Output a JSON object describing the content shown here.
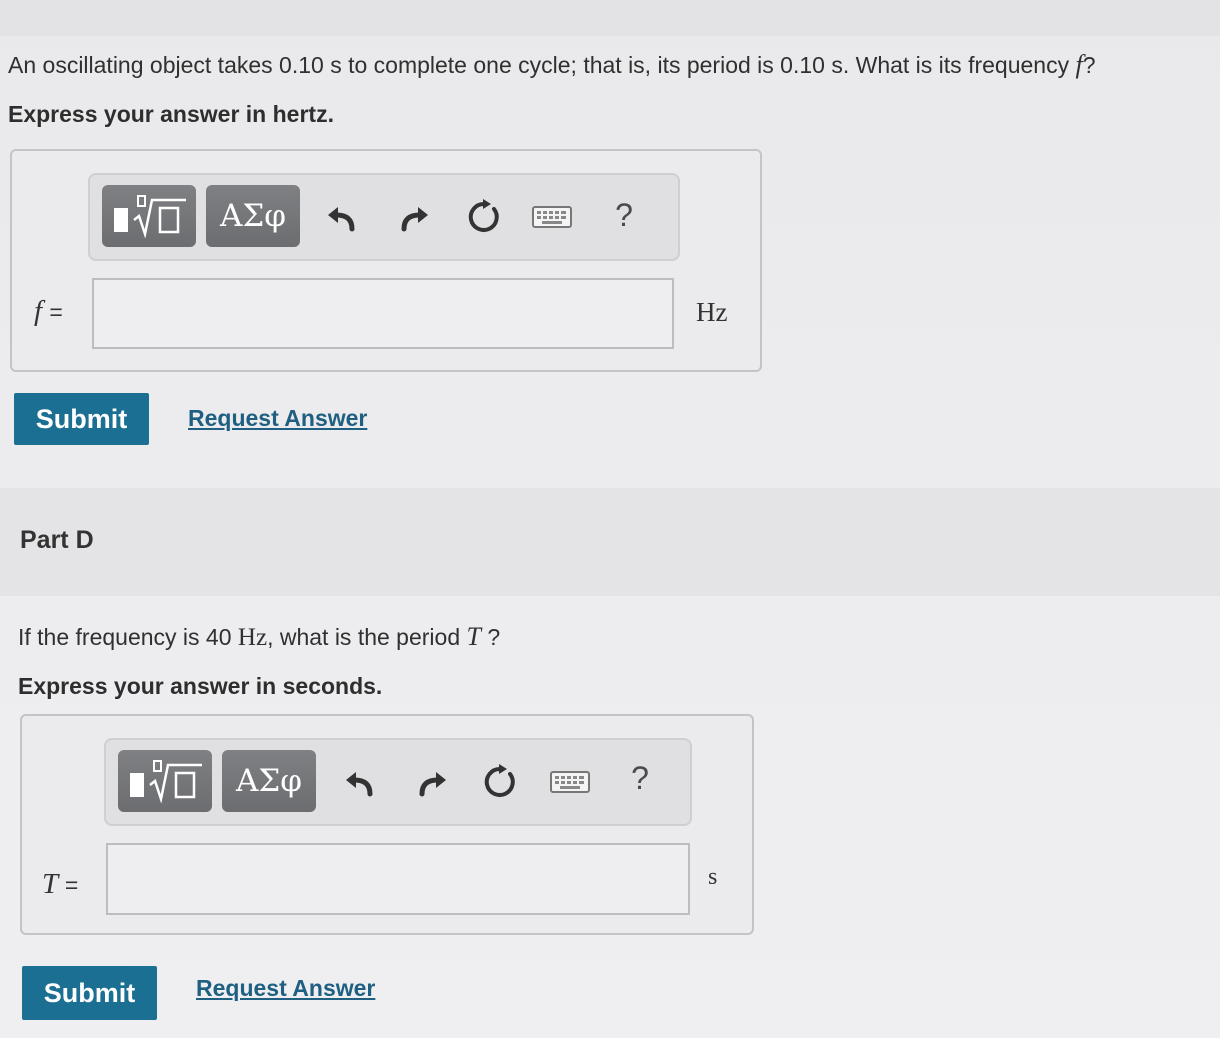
{
  "part_c": {
    "question_pre": "An oscillating object takes 0.10 s to complete one cycle; that is, its period is 0.10  s. What is its frequency ",
    "question_var": "f",
    "question_post": "?",
    "instruction": "Express your answer in hertz.",
    "toolbar": {
      "templates_icon": "fraction-root-template-icon",
      "greek_label": "ΑΣφ",
      "undo_icon": "undo-icon",
      "redo_icon": "redo-icon",
      "reset_icon": "reset-icon",
      "keyboard_icon": "keyboard-icon",
      "help_label": "?"
    },
    "variable": "f",
    "equals": "=",
    "input_value": "",
    "unit": "Hz",
    "submit_label": "Submit",
    "request_label": "Request Answer"
  },
  "part_d": {
    "title": "Part D",
    "question_pre": "If the frequency is 40 ",
    "question_unit": "Hz",
    "question_mid": ", what is the period ",
    "question_var": "T",
    "question_post": " ?",
    "instruction": "Express your answer in seconds.",
    "toolbar": {
      "templates_icon": "fraction-root-template-icon",
      "greek_label": "ΑΣφ",
      "undo_icon": "undo-icon",
      "redo_icon": "redo-icon",
      "reset_icon": "reset-icon",
      "keyboard_icon": "keyboard-icon",
      "help_label": "?"
    },
    "variable": "T",
    "equals": "=",
    "input_value": "",
    "unit": "s",
    "submit_label": "Submit",
    "request_label": "Request Answer"
  },
  "colors": {
    "submit_bg": "#1b6f93",
    "link": "#1f5f82",
    "toolbar_button": "#737477"
  }
}
